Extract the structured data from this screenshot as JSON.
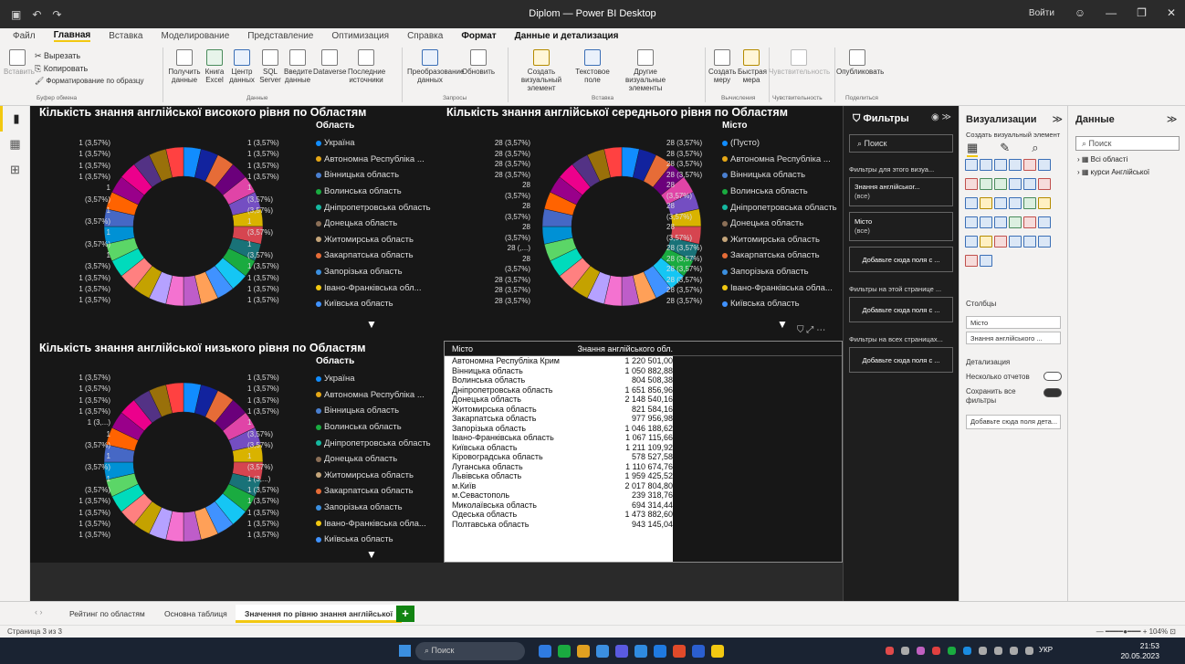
{
  "window": {
    "title": "Diplom — Power BI Desktop",
    "signin": "Войти"
  },
  "menu": [
    "Файл",
    "Главная",
    "Вставка",
    "Моделирование",
    "Представление",
    "Оптимизация",
    "Справка",
    "Формат",
    "Данные и детализация"
  ],
  "ribbon": {
    "paste": "Вставить",
    "cut": "Вырезать",
    "copy": "Копировать",
    "format_painter": "Форматирование по образцу",
    "get_data": "Получить данные",
    "excel": "Книга Excel",
    "data_hub": "Центр данных",
    "sql": "SQL Server",
    "enter_data": "Введите данные",
    "dataverse": "Dataverse",
    "recent": "Последние источники",
    "transform": "Преобразование данных",
    "refresh": "Обновить",
    "new_visual": "Создать визуальный элемент",
    "textbox": "Текстовое поле",
    "more_visuals": "Другие визуальные элементы",
    "new_measure": "Создать меру",
    "quick_measure": "Быстрая мера",
    "sensitivity": "Чувствительность",
    "publish": "Опубликовать",
    "groups": [
      "Буфер обмена",
      "Данные",
      "Запросы",
      "Вставка",
      "Вычисления",
      "Чувствительность",
      "Поделиться"
    ]
  },
  "charts": {
    "high": {
      "title": "Кількість знання англійської високого рівня по Областям",
      "legend_title": "Область",
      "legend": [
        "Україна",
        "Автономна Республіка ...",
        "Вінницька область",
        "Волинська область",
        "Дніпропетровська область",
        "Донецька область",
        "Житомирська область",
        "Закарпатська область",
        "Запорізька область",
        "Івано-Франківська обл...",
        "Київська область"
      ],
      "labels_left": [
        "1 (3,57%)",
        "1 (3,57%)",
        "1 (3,57%)",
        "1 (3,57%)",
        "1",
        "(3,57%)",
        "1",
        "(3,57%)",
        "1",
        "(3,57%)",
        "1",
        "(3,57%)",
        "1 (3,57%)",
        "1 (3,57%)",
        "1 (3,57%)"
      ],
      "labels_right": [
        "1 (3,57%)",
        "1 (3,57%)",
        "1 (3,57%)",
        "1 (3,57%)",
        "1",
        "(3,57%)",
        "(3,57%)",
        "1",
        "(3,57%)",
        "1",
        "(3,57%)",
        "1 (3,57%)",
        "1 (3,57%)",
        "1 (3,57%)",
        "1 (3,57%)"
      ]
    },
    "mid": {
      "title": "Кількість знання англійської середнього рівня по Областям",
      "legend_title": "Місто",
      "legend": [
        "(Пусто)",
        "Автономна Республіка ...",
        "Вінницька область",
        "Волинська область",
        "Дніпропетровська область",
        "Донецька область",
        "Житомирська область",
        "Закарпатська область",
        "Запорізька область",
        "Івано-Франківська обла...",
        "Київська область"
      ],
      "labels_left": [
        "28 (3,57%)",
        "28 (3,57%)",
        "28 (3,57%)",
        "28 (3,57%)",
        "28",
        "(3,57%)",
        "28",
        "(3,57%)",
        "28",
        "(3,57%)",
        "28 (,...)",
        "28",
        "(3,57%)",
        "28 (3,57%)",
        "28 (3,57%)",
        "28 (3,57%)"
      ],
      "labels_right": [
        "28 (3,57%)",
        "28 (3,57%)",
        "28 (3,57%)",
        "28 (3,57%)",
        "28",
        "(3,57%)",
        "28",
        "(3,57%)",
        "28",
        "(3,57%)",
        "28 (3,57%)",
        "28 (3,57%)",
        "28 (3,57%)",
        "28 (3,57%)",
        "28 (3,57%)",
        "28 (3,57%)"
      ]
    },
    "low": {
      "title": "Кількість знання англійської низького рівня по Областям",
      "legend_title": "Область",
      "legend": [
        "Україна",
        "Автономна Республіка ...",
        "Вінницька область",
        "Волинська область",
        "Дніпропетровська область",
        "Донецька область",
        "Житомирська область",
        "Закарпатська область",
        "Запорізька область",
        "Івано-Франківська обла...",
        "Київська область"
      ],
      "labels_left": [
        "1 (3,57%)",
        "1 (3,57%)",
        "1 (3,57%)",
        "1 (3,57%)",
        "1 (3,...)",
        "1",
        "(3,57%)",
        "1",
        "(3,57%)",
        "1",
        "(3,57%)",
        "1 (3,57%)",
        "1 (3,57%)",
        "1 (3,57%)",
        "1 (3,57%)"
      ],
      "labels_right": [
        "1 (3,57%)",
        "1 (3,57%)",
        "1 (3,57%)",
        "1 (3,57%)",
        "1",
        "(3,57%)",
        "(3,57%)",
        "1",
        "(3,57%)",
        "1 (3,...)",
        "1 (3,57%)",
        "1 (3,57%)",
        "1 (3,57%)",
        "1 (3,57%)",
        "1 (3,57%)"
      ]
    }
  },
  "slice_colors": [
    "#118dff",
    "#12239e",
    "#e66c37",
    "#6b007b",
    "#e044a7",
    "#744ec2",
    "#d9b300",
    "#d64550",
    "#197278",
    "#1aab40",
    "#15c6f4",
    "#4092ff",
    "#ffa058",
    "#be5dc9",
    "#f472d0",
    "#b5a1ff",
    "#c4a200",
    "#ff8080",
    "#00dbbc",
    "#5bd667",
    "#0091d5",
    "#4668c5",
    "#ff6300",
    "#99008a",
    "#ec008c",
    "#533285",
    "#99700a",
    "#ff4141",
    "#1f9a85",
    "#25891c"
  ],
  "chart_data": [
    {
      "type": "pie",
      "title": "Кількість знання англійської високого рівня по Областям",
      "legend_title": "Область",
      "slices": 28,
      "values": [
        1,
        1,
        1,
        1,
        1,
        1,
        1,
        1,
        1,
        1,
        1,
        1,
        1,
        1,
        1,
        1,
        1,
        1,
        1,
        1,
        1,
        1,
        1,
        1,
        1,
        1,
        1,
        1
      ],
      "percent_each": 3.57,
      "donut": true
    },
    {
      "type": "pie",
      "title": "Кількість знання англійської середнього рівня по Областям",
      "legend_title": "Місто",
      "slices": 28,
      "values": [
        28,
        28,
        28,
        28,
        28,
        28,
        28,
        28,
        28,
        28,
        28,
        28,
        28,
        28,
        28,
        28,
        28,
        28,
        28,
        28,
        28,
        28,
        28,
        28,
        28,
        28,
        28,
        28
      ],
      "percent_each": 3.57,
      "donut": true
    },
    {
      "type": "pie",
      "title": "Кількість знання англійської низького рівня по Областям",
      "legend_title": "Область",
      "slices": 28,
      "values": [
        1,
        1,
        1,
        1,
        1,
        1,
        1,
        1,
        1,
        1,
        1,
        1,
        1,
        1,
        1,
        1,
        1,
        1,
        1,
        1,
        1,
        1,
        1,
        1,
        1,
        1,
        1,
        1
      ],
      "percent_each": 3.57,
      "donut": true
    },
    {
      "type": "table",
      "columns": [
        "Місто",
        "Знання англійського обл."
      ],
      "rows": [
        [
          "Автономна Республіка Крим",
          "1 220 501,00"
        ],
        [
          "Вінницька область",
          "1 050 882,88"
        ],
        [
          "Волинська область",
          "804 508,38"
        ],
        [
          "Дніпропетровська область",
          "1 651 856,96"
        ],
        [
          "Донецька область",
          "2 148 540,16"
        ],
        [
          "Житомирська область",
          "821 584,16"
        ],
        [
          "Закарпатська область",
          "977 956,98"
        ],
        [
          "Запорізька область",
          "1 046 188,62"
        ],
        [
          "Івано-Франківська область",
          "1 067 115,66"
        ],
        [
          "Київська область",
          "1 211 109,92"
        ],
        [
          "Кіровоградська область",
          "578 527,58"
        ],
        [
          "Луганська область",
          "1 110 674,76"
        ],
        [
          "Львівська область",
          "1 959 425,52"
        ],
        [
          "м.Київ",
          "2 017 804,80"
        ],
        [
          "м.Севастополь",
          "239 318,76"
        ],
        [
          "Миколаївська область",
          "694 314,44"
        ],
        [
          "Одеська область",
          "1 473 882,60"
        ],
        [
          "Полтавська область",
          "943 145,04"
        ]
      ]
    }
  ],
  "filters": {
    "title": "Фильтры",
    "search": "Поиск",
    "this_visual": "Фильтры для этого визуа...",
    "card1_name": "Знання англійськог...",
    "card1_val": "(все)",
    "card2_name": "Місто",
    "card2_val": "(все)",
    "drop": "Добавьте сюда поля с ...",
    "this_page": "Фильтры на этой странице ...",
    "drop2": "Добавьте сюда поля с ...",
    "all_pages": "Фильтры на всех страницах...",
    "drop3": "Добавьте сюда поля с ..."
  },
  "viz": {
    "title": "Визуализации",
    "build": "Создать визуальный элемент",
    "columns": "Столбцы",
    "field1": "Місто",
    "field2": "Знання англійського ...",
    "drill": "Детализация",
    "cross_report": "Несколько отчетов",
    "keep_filters": "Сохранить все фильтры",
    "drill_drop": "Добавьте сюда поля дета..."
  },
  "data_pane": {
    "title": "Данные",
    "search": "Поиск",
    "items": [
      "Всі області",
      "курси Англійської"
    ]
  },
  "tabs": [
    "Рейтинг по областям",
    "Основна таблиця",
    "Значення по рівню знання англійської"
  ],
  "status": {
    "page": "Страница 3 из 3",
    "zoom": "104%"
  },
  "taskbar": {
    "search": "Поиск",
    "time": "21:53",
    "date": "20.05.2023",
    "lang": "УКР"
  }
}
